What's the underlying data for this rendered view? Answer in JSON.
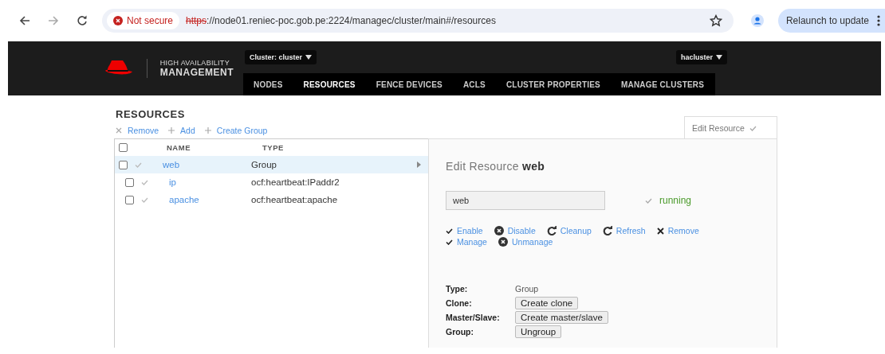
{
  "browser": {
    "security": "Not secure",
    "url_scheme": "https",
    "url_rest": "://node01.reniec-poc.gob.pe:2224/managec/cluster/main#/resources",
    "relaunch": "Relaunch to update"
  },
  "header": {
    "brand_top": "HIGH AVAILABILITY",
    "brand_bottom": "MANAGEMENT",
    "cluster_menu": "Cluster: cluster",
    "user_menu": "hacluster",
    "nav": [
      {
        "label": "NODES",
        "selected": false
      },
      {
        "label": "RESOURCES",
        "selected": true
      },
      {
        "label": "FENCE DEVICES",
        "selected": false
      },
      {
        "label": "ACLS",
        "selected": false
      },
      {
        "label": "CLUSTER PROPERTIES",
        "selected": false
      },
      {
        "label": "MANAGE CLUSTERS",
        "selected": false
      }
    ]
  },
  "page_title": "RESOURCES",
  "toolbar": [
    {
      "kind": "remove",
      "label": "Remove"
    },
    {
      "kind": "add",
      "label": "Add"
    },
    {
      "kind": "add",
      "label": "Create Group"
    }
  ],
  "table": {
    "all_checked": false,
    "columns": [
      "NAME",
      "TYPE"
    ],
    "rows": [
      {
        "name": "web",
        "type": "Group",
        "checked": false,
        "selected": true,
        "children": [
          {
            "name": "ip",
            "type": "ocf:heartbeat:IPaddr2",
            "checked": false,
            "selected": false
          },
          {
            "name": "apache",
            "type": "ocf:heartbeat:apache",
            "checked": false,
            "selected": false
          }
        ]
      }
    ]
  },
  "panel": {
    "tab": "Edit Resource",
    "heading_prefix": "Edit Resource",
    "heading_name": "web",
    "name_value": "web",
    "status": "running",
    "actions": [
      [
        {
          "kind": "check",
          "label": "Enable"
        },
        {
          "kind": "xcircle",
          "label": "Disable"
        },
        {
          "kind": "refresh",
          "label": "Cleanup"
        },
        {
          "kind": "refresh",
          "label": "Refresh"
        },
        {
          "kind": "x",
          "label": "Remove"
        }
      ],
      [
        {
          "kind": "check",
          "label": "Manage"
        },
        {
          "kind": "xcircle",
          "label": "Unmanage"
        }
      ]
    ],
    "details": [
      {
        "label": "Type:",
        "kind": "text",
        "value": "Group"
      },
      {
        "label": "Clone:",
        "kind": "button",
        "value": "Create clone"
      },
      {
        "label": "Master/Slave:",
        "kind": "button",
        "value": "Create master/slave"
      },
      {
        "label": "Group:",
        "kind": "button",
        "value": "Ungroup"
      }
    ]
  }
}
